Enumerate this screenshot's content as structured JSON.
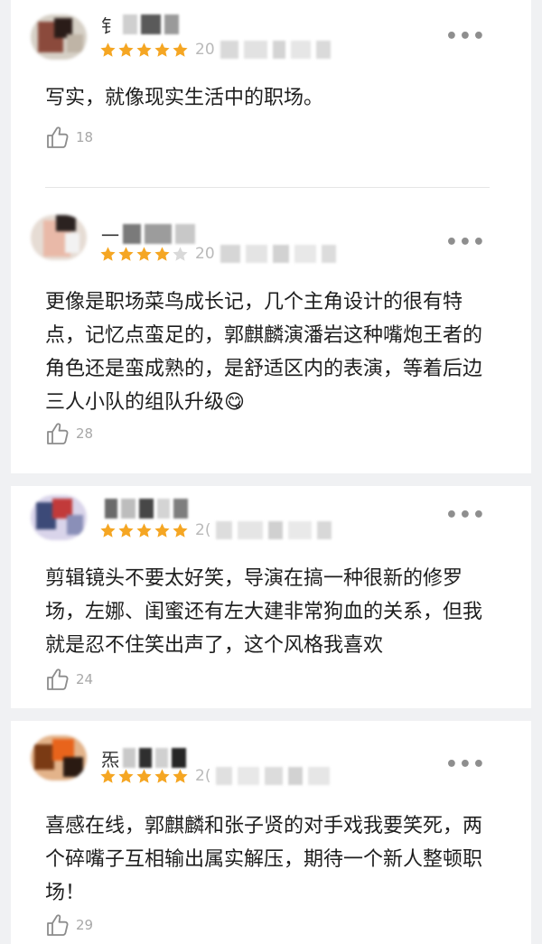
{
  "colors": {
    "star": "#f5a623",
    "star_empty": "#d9d9d9",
    "text": "#1e1e1e",
    "muted": "#a8a8a8",
    "background": "#f0f1f3"
  },
  "reviews": [
    {
      "name_visible": "钅",
      "date_prefix": "20",
      "rating": 5,
      "text": "写实，就像现实生活中的职场。",
      "likes": "18",
      "more_icon": "more-dots-icon"
    },
    {
      "name_visible": "一",
      "date_prefix": "20",
      "rating": 4,
      "text": "更像是职场菜鸟成长记，几个主角设计的很有特点，记忆点蛮足的，郭麒麟演潘岩这种嘴炮王者的角色还是蛮成熟的，是舒适区内的表演，等着后边三人小队的组队升级😋",
      "likes": "28",
      "more_icon": "more-dots-icon"
    },
    {
      "name_visible": "",
      "date_prefix": "2(",
      "rating": 5,
      "text": "剪辑镜头不要太好笑，导演在搞一种很新的修罗场，左娜、闺蜜还有左大建非常狗血的关系，但我就是忍不住笑出声了，这个风格我喜欢",
      "likes": "24",
      "more_icon": "more-dots-icon"
    },
    {
      "name_visible": "炁",
      "date_prefix": "2(",
      "rating": 5,
      "text": "喜感在线，郭麒麟和张子贤的对手戏我要笑死，两个碎嘴子互相输出属实解压，期待一个新人整顿职场！",
      "likes": "29",
      "more_icon": "more-dots-icon"
    }
  ]
}
